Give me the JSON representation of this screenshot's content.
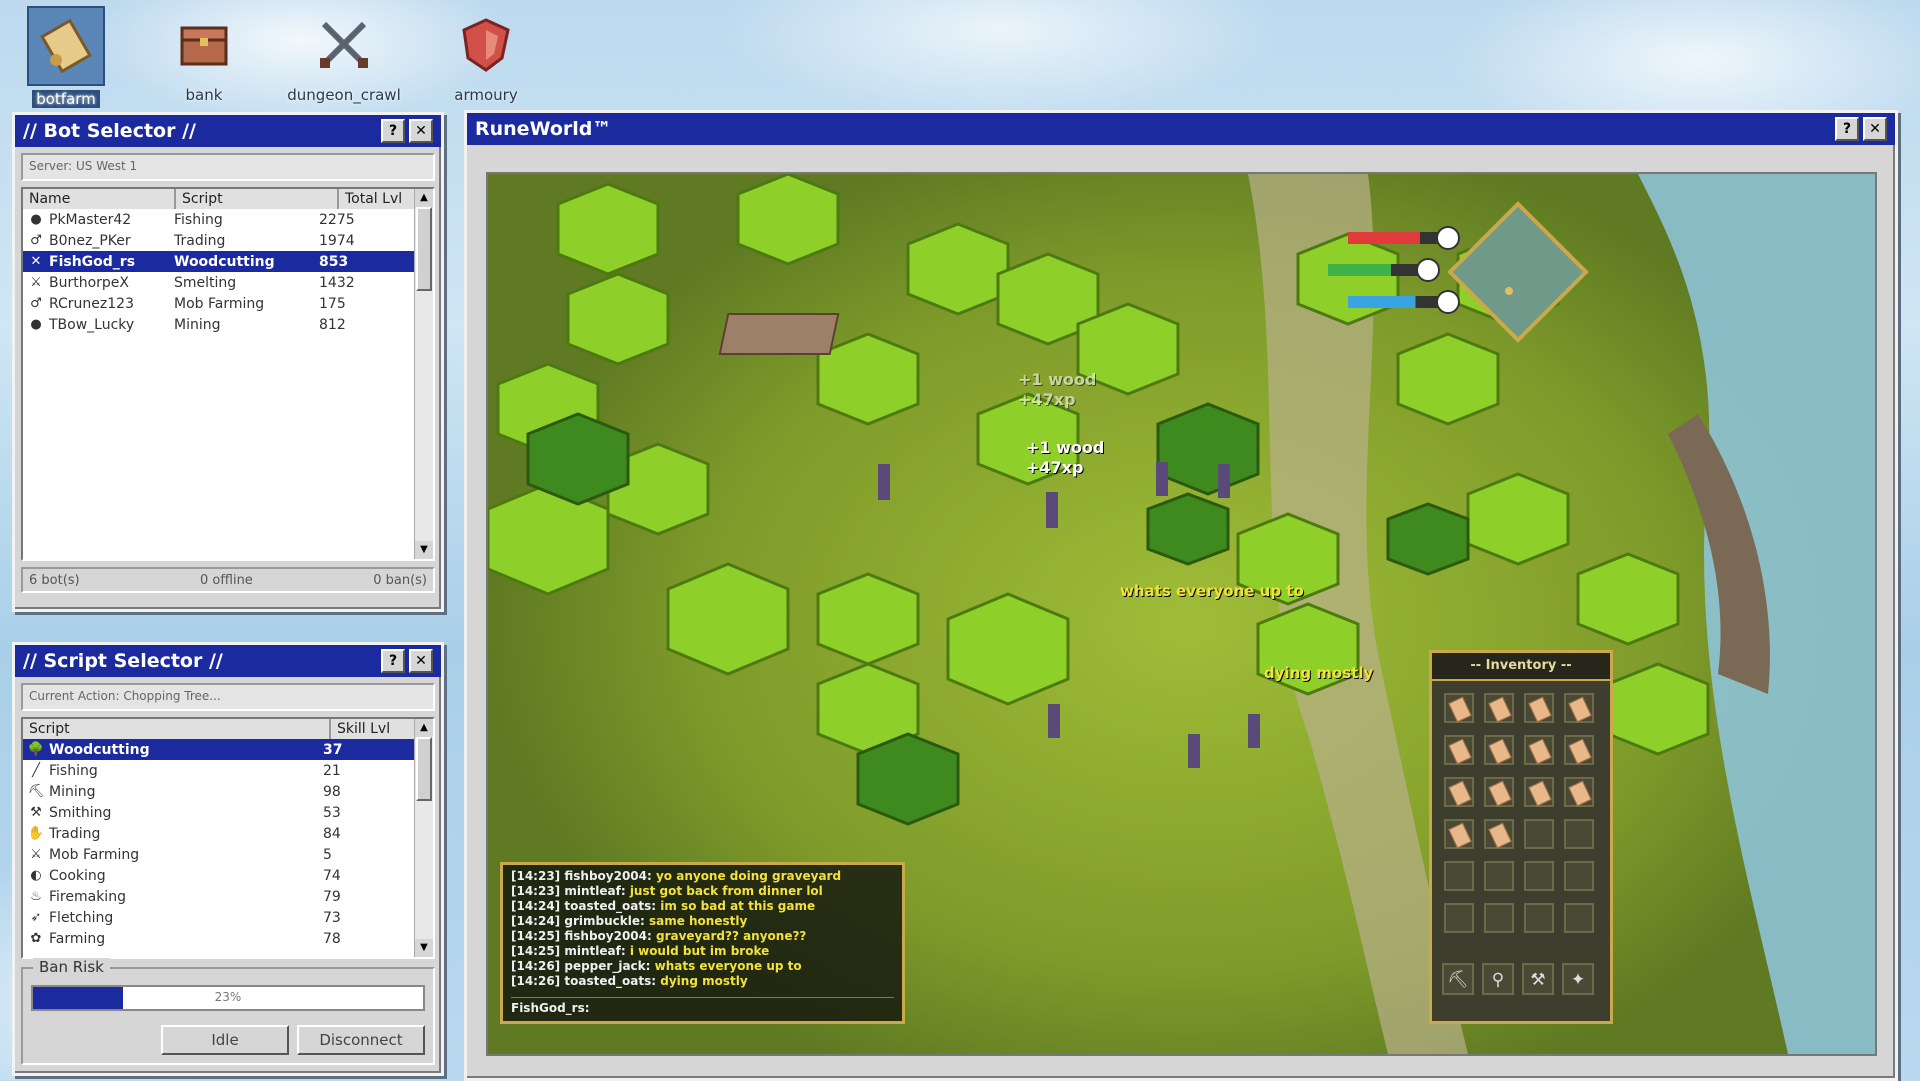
{
  "desktop": {
    "icons": [
      {
        "label": "botfarm",
        "icon": "scroll-icon"
      },
      {
        "label": "bank",
        "icon": "chest-icon"
      },
      {
        "label": "dungeon_crawl",
        "icon": "crossed-swords-icon"
      },
      {
        "label": "armoury",
        "icon": "shield-icon"
      }
    ]
  },
  "bot_selector": {
    "title": "// Bot Selector //",
    "server": "Server: US West 1",
    "columns": [
      "Name",
      "Script",
      "Total Lvl"
    ],
    "rows": [
      {
        "name": "PkMaster42",
        "script": "Fishing",
        "lvl": "2275"
      },
      {
        "name": "B0nez_PKer",
        "script": "Trading",
        "lvl": "1974"
      },
      {
        "name": "FishGod_rs",
        "script": "Woodcutting",
        "lvl": "853"
      },
      {
        "name": "BurthorpeX",
        "script": "Smelting",
        "lvl": "1432"
      },
      {
        "name": "RCrunez123",
        "script": "Mob Farming",
        "lvl": "175"
      },
      {
        "name": "TBow_Lucky",
        "script": "Mining",
        "lvl": "812"
      }
    ],
    "footer": {
      "bots": "6 bot(s)",
      "offline": "0 offline",
      "bans": "0 ban(s)"
    }
  },
  "script_selector": {
    "title": "// Script Selector //",
    "current_action": "Current Action: Chopping Tree...",
    "columns": [
      "Script",
      "Skill Lvl"
    ],
    "rows": [
      {
        "name": "Woodcutting",
        "lvl": "37"
      },
      {
        "name": "Fishing",
        "lvl": "21"
      },
      {
        "name": "Mining",
        "lvl": "98"
      },
      {
        "name": "Smithing",
        "lvl": "53"
      },
      {
        "name": "Trading",
        "lvl": "84"
      },
      {
        "name": "Mob Farming",
        "lvl": "5"
      },
      {
        "name": "Cooking",
        "lvl": "74"
      },
      {
        "name": "Firemaking",
        "lvl": "79"
      },
      {
        "name": "Fletching",
        "lvl": "73"
      },
      {
        "name": "Farming",
        "lvl": "78"
      }
    ],
    "ban_risk_label": "Ban Risk",
    "ban_risk_value": 0.23,
    "ban_risk_text": "23%",
    "idle_label": "Idle",
    "disconnect_label": "Disconnect"
  },
  "game": {
    "title": "RuneWorld™",
    "floats": [
      {
        "line1": "+1 wood",
        "line2": "+47xp"
      },
      {
        "line1": "+1 wood",
        "line2": "+47xp"
      }
    ],
    "speech": [
      "whats everyone up to",
      "dying mostly"
    ],
    "chat": [
      {
        "time": "[14:23]",
        "who": "fishboy2004:",
        "msg": "yo anyone doing graveyard"
      },
      {
        "time": "[14:23]",
        "who": "mintleaf:",
        "msg": "just got back from dinner lol"
      },
      {
        "time": "[14:24]",
        "who": "toasted_oats:",
        "msg": "im so bad at this game"
      },
      {
        "time": "[14:24]",
        "who": "grimbuckle:",
        "msg": "same honestly"
      },
      {
        "time": "[14:25]",
        "who": "fishboy2004:",
        "msg": "graveyard?? anyone??"
      },
      {
        "time": "[14:25]",
        "who": "mintleaf:",
        "msg": "i would but im broke"
      },
      {
        "time": "[14:26]",
        "who": "pepper_jack:",
        "msg": "whats everyone up to"
      },
      {
        "time": "[14:26]",
        "who": "toasted_oats:",
        "msg": "dying mostly"
      }
    ],
    "chat_input": "FishGod_rs:",
    "inventory_title": "-- Inventory --",
    "inventory_wood_count": 14,
    "inventory_slots": 24,
    "tools": [
      "pickaxe-icon",
      "shovel-icon",
      "hammer-icon",
      "compass-icon"
    ],
    "health": 0.8,
    "prayer": 0.7,
    "energy": 0.75
  }
}
